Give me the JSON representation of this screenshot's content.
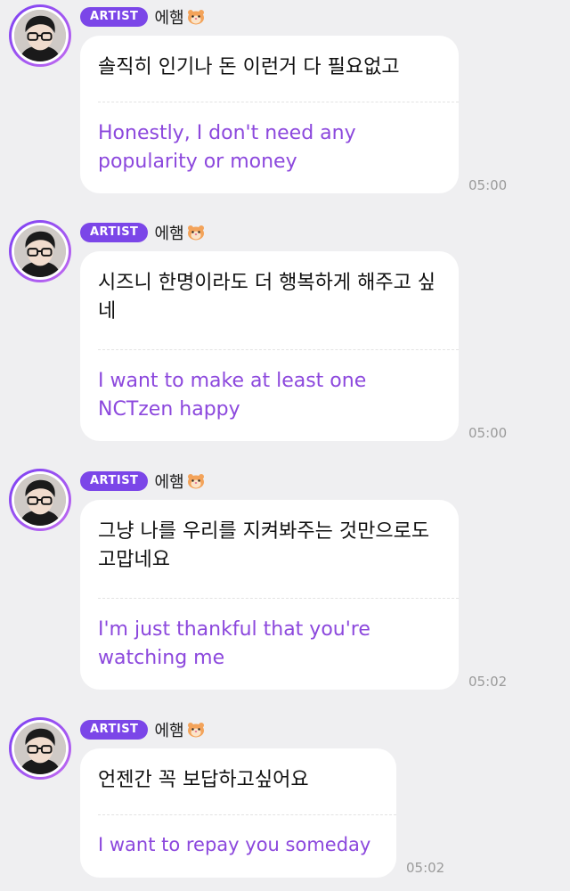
{
  "artist_badge": "ARTIST",
  "artist_name": "에햄",
  "name_emoji": "hamster-icon",
  "colors": {
    "background": "#efeff1",
    "badge": "#7b46e8",
    "translation": "#8c48dd",
    "avatar_ring": "#7b3ff2"
  },
  "messages": [
    {
      "original": "솔직히 인기나 돈 이런거 다 필요없고",
      "translation": "Honestly, I don't need any popularity or money",
      "time": "05:00"
    },
    {
      "original": "시즈니 한명이라도 더 행복하게 해주고 싶네",
      "translation": "I want to make at least one NCTzen happy",
      "time": "05:00"
    },
    {
      "original": "그냥 나를 우리를 지켜봐주는 것만으로도 고맙네요",
      "translation": "I'm just thankful that you're watching me",
      "time": "05:02"
    },
    {
      "original": "언젠간 꼭 보답하고싶어요",
      "translation": "I want to repay you someday",
      "time": "05:02"
    }
  ]
}
